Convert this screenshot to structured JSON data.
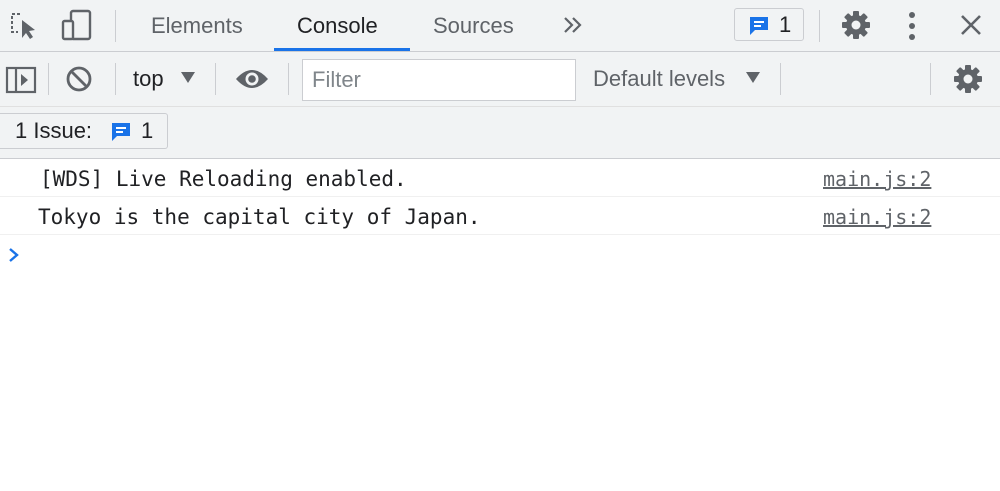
{
  "tabs": [
    {
      "label": "Elements"
    },
    {
      "label": "Console"
    },
    {
      "label": "Sources"
    }
  ],
  "active_tab": "Console",
  "issues_badge_count": "1",
  "toolbar": {
    "context": "top",
    "filter_placeholder": "Filter",
    "levels": "Default levels"
  },
  "issue_bar": {
    "label": "1 Issue:",
    "count": "1"
  },
  "messages": [
    {
      "text": "[WDS] Live Reloading enabled.",
      "source": "main.js:2"
    },
    {
      "text": "Tokyo is the capital city of Japan.",
      "source": "main.js:2"
    }
  ],
  "colors": {
    "accent": "#1a73e8",
    "toolbar_bg": "#f1f3f4",
    "icon": "#5f6368"
  },
  "icons": [
    "inspect-icon",
    "device-toolbar-icon",
    "more-tabs-icon",
    "issues-icon",
    "settings-icon",
    "kebab-menu-icon",
    "close-icon",
    "sidebar-toggle-icon",
    "clear-console-icon",
    "dropdown-arrow-icon",
    "live-expression-icon",
    "console-settings-icon",
    "console-prompt-icon"
  ]
}
